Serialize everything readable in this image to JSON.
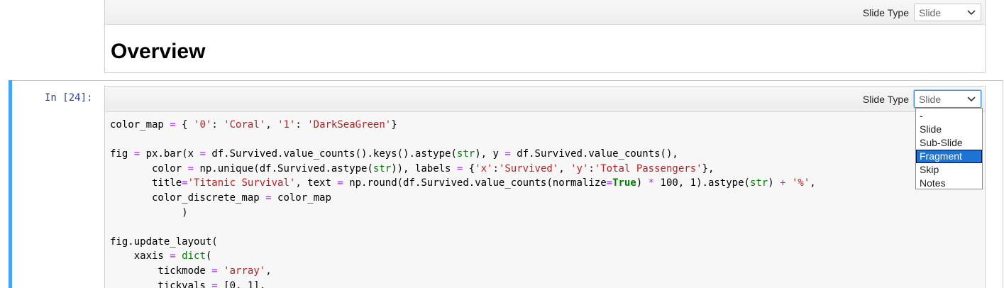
{
  "markdown_cell": {
    "toolbar": {
      "label": "Slide Type",
      "selected": "Slide"
    },
    "heading": "Overview"
  },
  "code_cell": {
    "prompt": "In [24]:",
    "toolbar": {
      "label": "Slide Type",
      "selected": "Slide"
    },
    "dropdown": {
      "options": [
        "-",
        "Slide",
        "Sub-Slide",
        "Fragment",
        "Skip",
        "Notes"
      ],
      "highlighted": "Fragment"
    }
  },
  "colors": {
    "selection_bar": "#42a5f5",
    "highlight": "#1e73d6"
  }
}
